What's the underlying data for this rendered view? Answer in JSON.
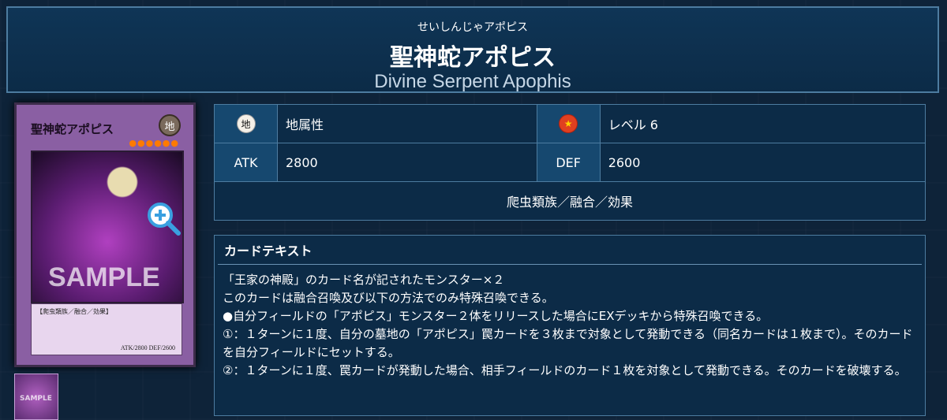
{
  "header": {
    "ruby": "せいしんじゃアポピス",
    "name_jp": "聖神蛇アポピス",
    "name_en": "Divine Serpent Apophis"
  },
  "card_image": {
    "card_name": "聖神蛇アポピス",
    "attribute_glyph": "地",
    "stars": "●●●●●●",
    "sample_text": "SAMPLE",
    "type_line": "【爬虫類族／融合／効果】",
    "stats_line": "ATK/2800  DEF/2600",
    "frame_color": "#8a5fa3"
  },
  "stats": {
    "attribute_icon_glyph": "地",
    "attribute": "地属性",
    "level_icon": "star-icon",
    "level": "レベル 6",
    "atk_label": "ATK",
    "atk": "2800",
    "def_label": "DEF",
    "def": "2600",
    "types": "爬虫類族／融合／効果"
  },
  "card_text": {
    "heading": "カードテキスト",
    "lines": [
      "「王家の神殿」のカード名が記されたモンスター×２",
      "このカードは融合召喚及び以下の方法でのみ特殊召喚できる。",
      "●自分フィールドの「アポピス」モンスター２体をリリースした場合にEXデッキから特殊召喚できる。",
      "①：１ターンに１度、自分の墓地の「アポピス」罠カードを３枚まで対象として発動できる（同名カードは１枚まで）。そのカードを自分フィールドにセットする。",
      "②：１ターンに１度、罠カードが発動した場合、相手フィールドのカード１枚を対象として発動できる。そのカードを破壊する。"
    ]
  },
  "thumbnail": {
    "sample_text": "SAMPLE"
  },
  "colors": {
    "background": "#0e2339",
    "panel": "#0c2b47",
    "label_cell": "#16486f",
    "border": "#4d7ca0"
  }
}
